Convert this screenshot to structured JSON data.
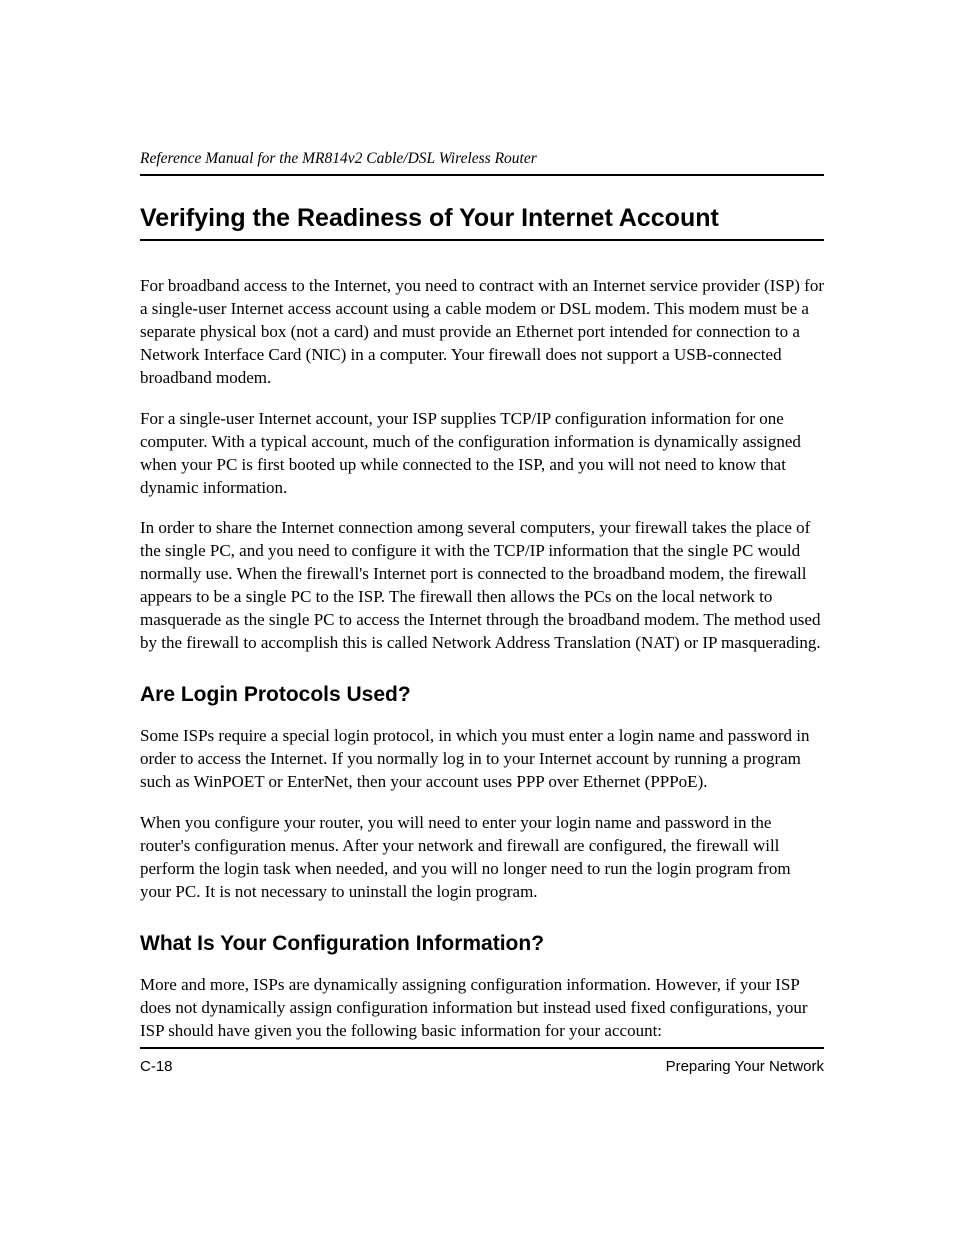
{
  "header": {
    "running_title": "Reference Manual for the MR814v2 Cable/DSL Wireless Router"
  },
  "section": {
    "title": "Verifying the Readiness of Your Internet Account",
    "paragraphs": [
      "For broadband access to the Internet, you need to contract with an Internet service provider (ISP) for a single-user Internet access account using a cable modem or DSL modem. This modem must be a separate physical box (not a card) and must provide an Ethernet port intended for connection to a Network Interface Card (NIC) in a computer. Your firewall does not support a USB-connected broadband modem.",
      "For a single-user Internet account, your ISP supplies TCP/IP configuration information for one computer. With a typical account, much of the configuration information is dynamically assigned when your PC is first booted up while connected to the ISP, and you will not need to know that dynamic information.",
      "In order to share the Internet connection among several computers, your firewall takes the place of the single PC, and you need to configure it with the TCP/IP information that the single PC would normally use. When the firewall's Internet port is connected to the broadband modem, the firewall appears to be a single PC to the ISP. The firewall then allows the PCs on the local network to masquerade as the single PC to access the Internet through the broadband modem. The method used by the firewall to accomplish this is called Network Address Translation (NAT) or IP masquerading."
    ]
  },
  "subsection1": {
    "title": "Are Login Protocols Used?",
    "paragraphs": [
      "Some ISPs require a special login protocol, in which you must enter a login name and password in order to access the Internet. If you normally log in to your Internet account by running a program such as WinPOET or EnterNet, then your account uses PPP over Ethernet (PPPoE).",
      "When you configure your router, you will need to enter your login name and password in the router's configuration menus. After your network and firewall are configured, the firewall will perform the login task when needed, and you will no longer need to run the login program from your PC. It is not necessary to uninstall the login program."
    ]
  },
  "subsection2": {
    "title": "What Is Your Configuration Information?",
    "paragraphs": [
      "More and more, ISPs are dynamically assigning configuration information. However, if your ISP does not dynamically assign configuration information but instead used fixed configurations, your ISP should have given you the following basic information for your account:"
    ]
  },
  "footer": {
    "page_number": "C-18",
    "chapter": "Preparing Your Network"
  }
}
